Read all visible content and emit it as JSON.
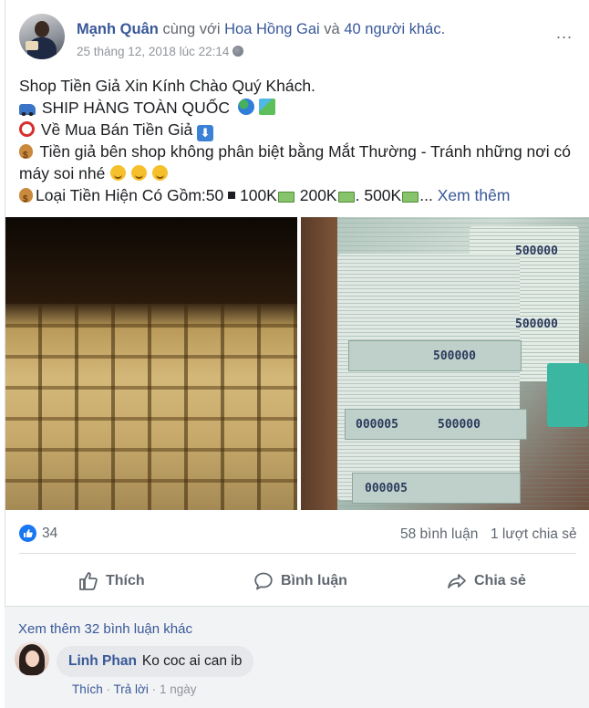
{
  "post": {
    "author": "Mạnh Quân",
    "with_text": "cùng với",
    "tagged": "Hoa Hồng Gai",
    "and_text": "và",
    "others": "40 người khác.",
    "timestamp": "25 tháng 12, 2018 lúc 22:14",
    "more_menu": "...",
    "lines": {
      "l1": "Shop Tiền Giả Xin Kính Chào Quý Khách.",
      "l2": "SHIP HÀNG TOÀN QUỐC",
      "l3": "Về Mua Bán Tiền Giả",
      "l4": "Tiền giả bên shop không phân biệt bằng Mắt Thường - Tránh những nơi có",
      "l5": "máy soi nhé",
      "l6a": "Loại Tiền Hiện Có Gồm:50",
      "l6b": "100K",
      "l6c": "200K",
      "l6d": ". 500K",
      "l6e": "...",
      "see_more": "Xem thêm"
    },
    "photo_numbers": [
      "500000",
      "500000",
      "000005",
      "500000",
      "000005",
      "500000"
    ]
  },
  "stats": {
    "likes": "34",
    "comments": "58 bình luận",
    "shares": "1 lượt chia sẻ"
  },
  "actions": {
    "like": "Thích",
    "comment": "Bình luận",
    "share": "Chia sẻ"
  },
  "comments": {
    "view_more": "Xem thêm 32 bình luận khác",
    "items": [
      {
        "name": "Linh Phan",
        "text": "Ko coc ai can ib",
        "like": "Thích",
        "reply": "Trả lời",
        "sep": "·",
        "time": "1 ngày"
      }
    ]
  },
  "colors": {
    "link": "#385898",
    "like_blue": "#1877f2",
    "meta_gray": "#90949c"
  }
}
